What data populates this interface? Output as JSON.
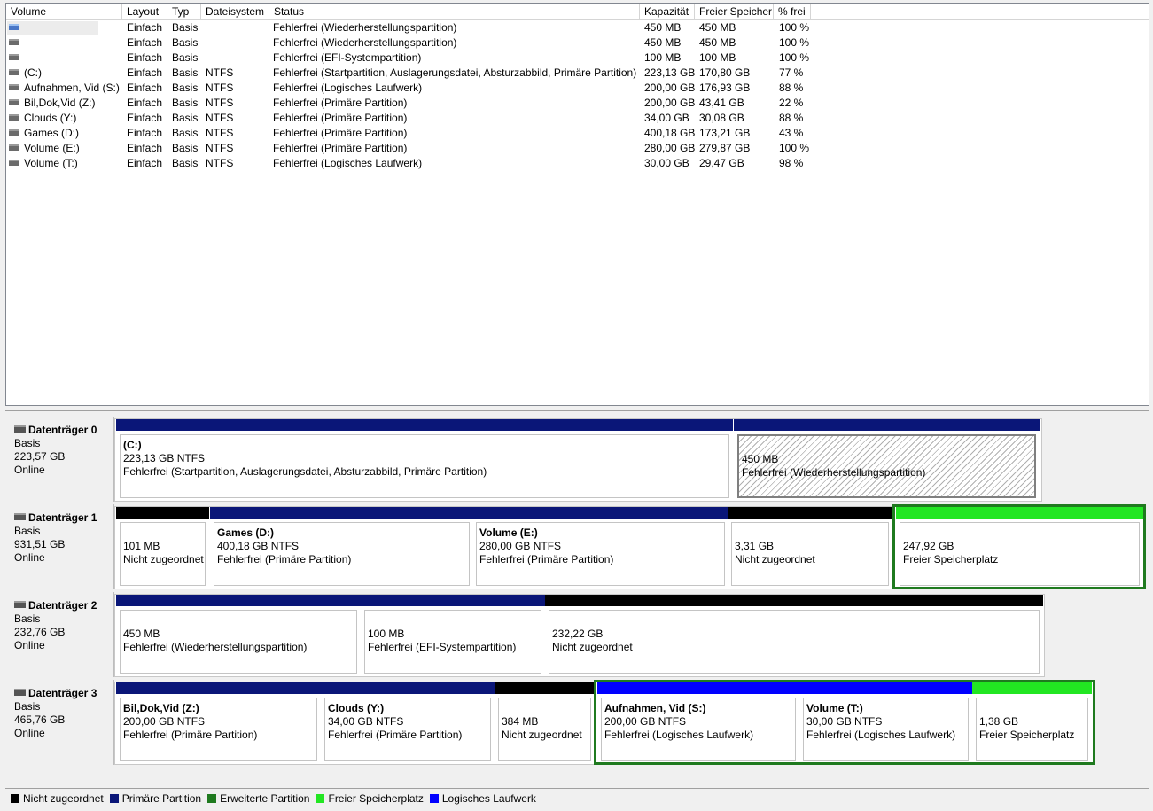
{
  "columns": [
    "Volume",
    "Layout",
    "Typ",
    "Dateisystem",
    "Status",
    "Kapazität",
    "Freier Speicher",
    "% frei"
  ],
  "volumes": [
    {
      "name": "",
      "layout": "Einfach",
      "type": "Basis",
      "fs": "",
      "status": "Fehlerfrei (Wiederherstellungspartition)",
      "cap": "450 MB",
      "free": "450 MB",
      "pct": "100 %"
    },
    {
      "name": "",
      "layout": "Einfach",
      "type": "Basis",
      "fs": "",
      "status": "Fehlerfrei (Wiederherstellungspartition)",
      "cap": "450 MB",
      "free": "450 MB",
      "pct": "100 %"
    },
    {
      "name": "",
      "layout": "Einfach",
      "type": "Basis",
      "fs": "",
      "status": "Fehlerfrei (EFI-Systempartition)",
      "cap": "100 MB",
      "free": "100 MB",
      "pct": "100 %"
    },
    {
      "name": " (C:)",
      "layout": "Einfach",
      "type": "Basis",
      "fs": "NTFS",
      "status": "Fehlerfrei (Startpartition, Auslagerungsdatei, Absturzabbild, Primäre Partition)",
      "cap": "223,13 GB",
      "free": "170,80 GB",
      "pct": "77 %"
    },
    {
      "name": "Aufnahmen, Vid (S:)",
      "layout": "Einfach",
      "type": "Basis",
      "fs": "NTFS",
      "status": "Fehlerfrei (Logisches Laufwerk)",
      "cap": "200,00 GB",
      "free": "176,93 GB",
      "pct": "88 %"
    },
    {
      "name": "Bil,Dok,Vid (Z:)",
      "layout": "Einfach",
      "type": "Basis",
      "fs": "NTFS",
      "status": "Fehlerfrei (Primäre Partition)",
      "cap": "200,00 GB",
      "free": "43,41 GB",
      "pct": "22 %"
    },
    {
      "name": "Clouds (Y:)",
      "layout": "Einfach",
      "type": "Basis",
      "fs": "NTFS",
      "status": "Fehlerfrei (Primäre Partition)",
      "cap": "34,00 GB",
      "free": "30,08 GB",
      "pct": "88 %"
    },
    {
      "name": "Games (D:)",
      "layout": "Einfach",
      "type": "Basis",
      "fs": "NTFS",
      "status": "Fehlerfrei (Primäre Partition)",
      "cap": "400,18 GB",
      "free": "173,21 GB",
      "pct": "43 %"
    },
    {
      "name": "Volume (E:)",
      "layout": "Einfach",
      "type": "Basis",
      "fs": "NTFS",
      "status": "Fehlerfrei (Primäre Partition)",
      "cap": "280,00 GB",
      "free": "279,87 GB",
      "pct": "100 %"
    },
    {
      "name": "Volume (T:)",
      "layout": "Einfach",
      "type": "Basis",
      "fs": "NTFS",
      "status": "Fehlerfrei (Logisches Laufwerk)",
      "cap": "30,00 GB",
      "free": "29,47 GB",
      "pct": "98 %"
    }
  ],
  "disks": [
    {
      "title": "Datenträger 0",
      "type": "Basis",
      "size": "223,57 GB",
      "state": "Online",
      "parts": [
        {
          "kind": "primary",
          "name": " (C:)",
          "size": "223,13 GB NTFS",
          "status": "Fehlerfrei (Startpartition, Auslagerungsdatei, Absturzabbild, Primäre Partition)"
        },
        {
          "kind": "primary",
          "name": "",
          "size": "450 MB",
          "status": "Fehlerfrei (Wiederherstellungspartition)",
          "hatched": true,
          "selected": true
        }
      ]
    },
    {
      "title": "Datenträger 1",
      "type": "Basis",
      "size": "931,51 GB",
      "state": "Online",
      "parts": [
        {
          "kind": "unallocated",
          "name": "",
          "size": "101 MB",
          "status": "Nicht zugeordnet"
        },
        {
          "kind": "primary",
          "name": "Games  (D:)",
          "size": "400,18 GB NTFS",
          "status": "Fehlerfrei (Primäre Partition)"
        },
        {
          "kind": "primary",
          "name": "Volume  (E:)",
          "size": "280,00 GB NTFS",
          "status": "Fehlerfrei (Primäre Partition)"
        },
        {
          "kind": "unallocated",
          "name": "",
          "size": "3,31 GB",
          "status": "Nicht zugeordnet"
        },
        {
          "kind": "free",
          "name": "",
          "size": "247,92 GB",
          "status": "Freier Speicherplatz"
        }
      ]
    },
    {
      "title": "Datenträger 2",
      "type": "Basis",
      "size": "232,76 GB",
      "state": "Online",
      "parts": [
        {
          "kind": "primary",
          "name": "",
          "size": "450 MB",
          "status": "Fehlerfrei (Wiederherstellungspartition)"
        },
        {
          "kind": "primary",
          "name": "",
          "size": "100 MB",
          "status": "Fehlerfrei (EFI-Systempartition)"
        },
        {
          "kind": "unallocated",
          "name": "",
          "size": "232,22 GB",
          "status": "Nicht zugeordnet"
        }
      ]
    },
    {
      "title": "Datenträger 3",
      "type": "Basis",
      "size": "465,76 GB",
      "state": "Online",
      "parts": [
        {
          "kind": "primary",
          "name": "Bil,Dok,Vid  (Z:)",
          "size": "200,00 GB NTFS",
          "status": "Fehlerfrei (Primäre Partition)"
        },
        {
          "kind": "primary",
          "name": "Clouds  (Y:)",
          "size": "34,00 GB NTFS",
          "status": "Fehlerfrei (Primäre Partition)"
        },
        {
          "kind": "unallocated",
          "name": "",
          "size": "384 MB",
          "status": "Nicht zugeordnet"
        },
        {
          "kind": "logical",
          "name": "Aufnahmen, Vid  (S:)",
          "size": "200,00 GB NTFS",
          "status": "Fehlerfrei (Logisches Laufwerk)"
        },
        {
          "kind": "logical",
          "name": "Volume  (T:)",
          "size": "30,00 GB NTFS",
          "status": "Fehlerfrei (Logisches Laufwerk)"
        },
        {
          "kind": "free",
          "name": "",
          "size": "1,38 GB",
          "status": "Freier Speicherplatz"
        }
      ]
    }
  ],
  "legend": [
    {
      "label": "Nicht zugeordnet",
      "color": "#000000"
    },
    {
      "label": "Primäre Partition",
      "color": "#0a1678"
    },
    {
      "label": "Erweiterte Partition",
      "color": "#1f7a1f"
    },
    {
      "label": "Freier Speicherplatz",
      "color": "#22e622"
    },
    {
      "label": "Logisches Laufwerk",
      "color": "#0000ff"
    }
  ],
  "colors": {
    "unallocated": "#000000",
    "primary": "#0a1678",
    "logical": "#0000ff",
    "free": "#22e622",
    "extended": "#1f7a1f"
  },
  "icons": {
    "volume": "disk-volume-icon",
    "disk": "hard-disk-icon"
  }
}
